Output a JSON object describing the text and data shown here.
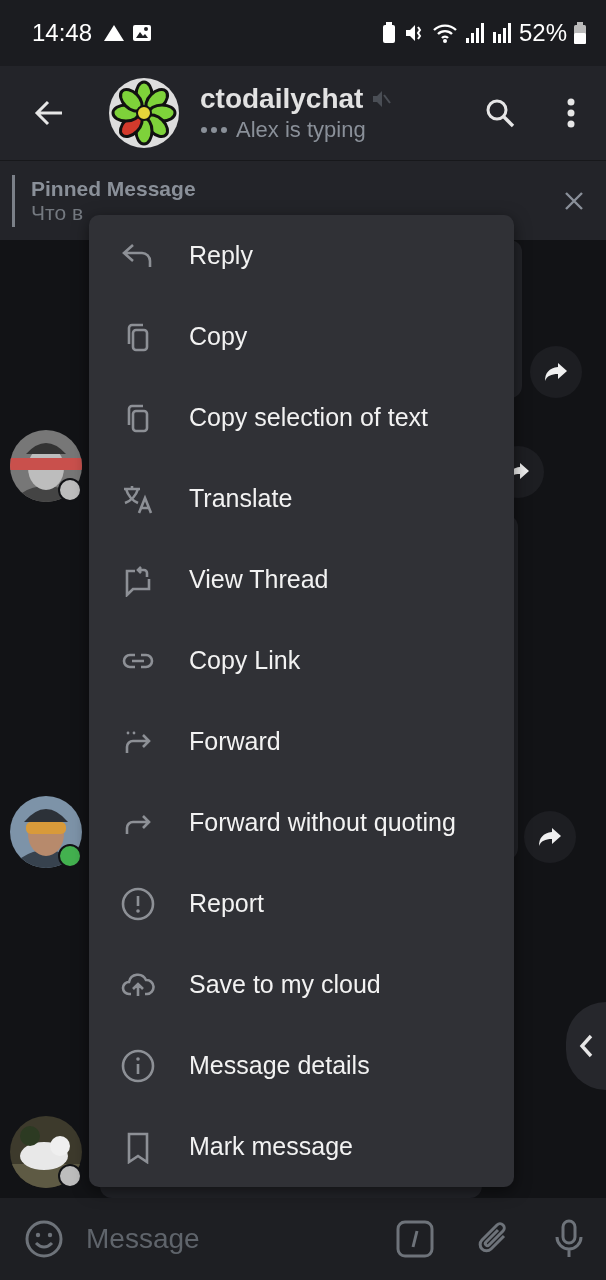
{
  "status_bar": {
    "time": "14:48",
    "battery": "52%"
  },
  "header": {
    "title": "ctodailychat",
    "muted": true,
    "subtitle": "Alex is typing"
  },
  "pinned": {
    "label": "Pinned Message",
    "text": "Что в"
  },
  "chat": {
    "avatars": [
      {
        "online": false
      },
      {
        "online": true
      },
      {
        "online": false
      }
    ]
  },
  "context_menu": [
    {
      "label": "Reply"
    },
    {
      "label": "Copy"
    },
    {
      "label": "Copy selection of text"
    },
    {
      "label": "Translate"
    },
    {
      "label": "View Thread"
    },
    {
      "label": "Copy Link"
    },
    {
      "label": "Forward"
    },
    {
      "label": "Forward without quoting"
    },
    {
      "label": "Report"
    },
    {
      "label": "Save to my cloud"
    },
    {
      "label": "Message details"
    },
    {
      "label": "Mark message"
    }
  ],
  "composer": {
    "placeholder": "Message"
  }
}
